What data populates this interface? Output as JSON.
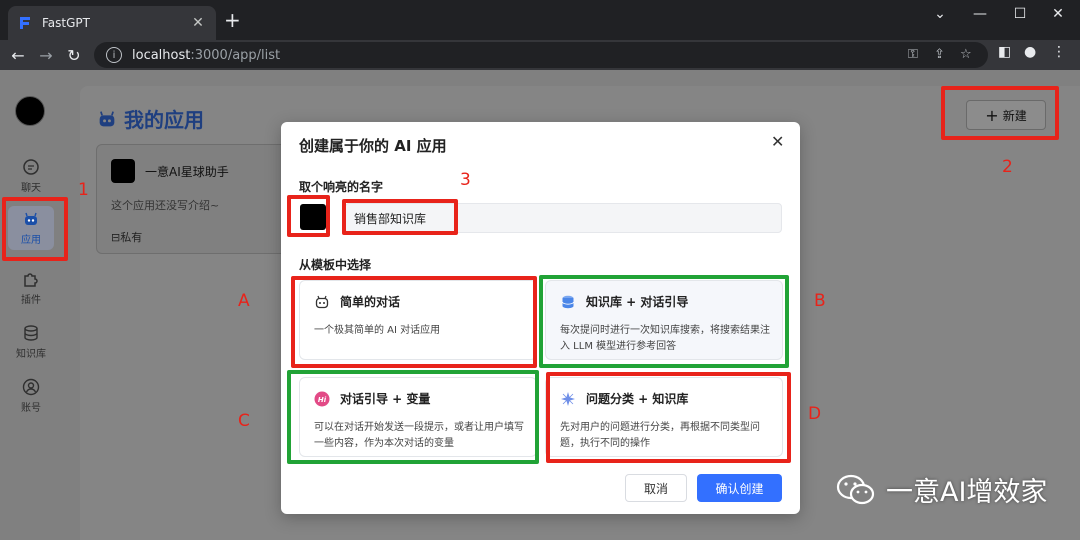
{
  "browser": {
    "tab_title": "FastGPT",
    "url_host": "localhost",
    "url_rest": ":3000/app/list"
  },
  "sidebar": {
    "items": [
      {
        "label": "聊天",
        "icon": "chat-icon"
      },
      {
        "label": "应用",
        "icon": "robot-icon",
        "active": true
      },
      {
        "label": "插件",
        "icon": "puzzle-icon"
      },
      {
        "label": "知识库",
        "icon": "database-icon"
      },
      {
        "label": "账号",
        "icon": "user-icon"
      }
    ]
  },
  "main": {
    "title": "我的应用",
    "new_button": "新建",
    "card": {
      "name": "一意AI星球助手",
      "desc": "这个应用还没写介绍~",
      "privacy": "私有"
    }
  },
  "modal": {
    "title": "创建属于你的 AI 应用",
    "name_label": "取个响亮的名字",
    "name_value": "销售部知识库",
    "template_label": "从模板中选择",
    "templates": [
      {
        "title": "简单的对话",
        "desc": "一个极其简单的 AI 对话应用",
        "icon": "robot-face-icon"
      },
      {
        "title": "知识库 + 对话引导",
        "desc": "每次提问时进行一次知识库搜索，将搜索结果注入 LLM 模型进行参考回答",
        "icon": "database-icon"
      },
      {
        "title": "对话引导 + 变量",
        "desc": "可以在对话开始发送一段提示，或者让用户填写一些内容，作为本次对话的变量",
        "icon": "hi-icon"
      },
      {
        "title": "问题分类 + 知识库",
        "desc": "先对用户的问题进行分类，再根据不同类型问题，执行不同的操作",
        "icon": "sparkle-icon"
      }
    ],
    "cancel": "取消",
    "confirm": "确认创建"
  },
  "annotations": {
    "m1": "1",
    "m2": "2",
    "m3": "3",
    "a": "A",
    "b": "B",
    "c": "C",
    "d": "D"
  },
  "watermark": "一意AI增效家",
  "colors": {
    "accent": "#3370ff",
    "annotation_red": "#e8231a",
    "annotation_green": "#21a336"
  }
}
